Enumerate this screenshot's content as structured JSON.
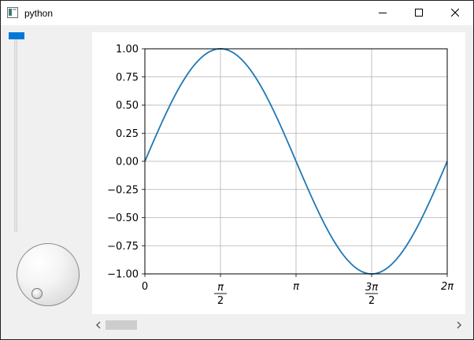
{
  "window": {
    "title": "python"
  },
  "slider": {
    "value_fraction": 1.0
  },
  "dial": {
    "value_fraction": 0.0
  },
  "chart_data": {
    "type": "line",
    "title": "",
    "xlabel": "",
    "ylabel": "",
    "xlim": [
      0,
      6.283185307179586
    ],
    "ylim": [
      -1.0,
      1.0
    ],
    "grid": true,
    "x_ticks": [
      0,
      1.5707963267948966,
      3.141592653589793,
      4.71238898038469,
      6.283185307179586
    ],
    "x_tick_labels": [
      {
        "kind": "plain",
        "text": "0"
      },
      {
        "kind": "frac",
        "num": "π",
        "den": "2"
      },
      {
        "kind": "plain",
        "text": "π"
      },
      {
        "kind": "frac",
        "num": "3π",
        "den": "2"
      },
      {
        "kind": "plain",
        "text": "2π"
      }
    ],
    "y_ticks": [
      1.0,
      0.75,
      0.5,
      0.25,
      0.0,
      -0.25,
      -0.5,
      -0.75,
      -1.0
    ],
    "y_tick_labels": [
      "1.00",
      "0.75",
      "0.50",
      "0.25",
      "0.00",
      "−0.25",
      "−0.50",
      "−0.75",
      "−1.00"
    ],
    "series": [
      {
        "color": "#1f77b4",
        "x": [
          0,
          0.3927,
          0.7854,
          1.1781,
          1.5708,
          1.9635,
          2.3562,
          2.7489,
          3.1416,
          3.5343,
          3.927,
          4.3197,
          4.7124,
          5.1051,
          5.4978,
          5.8905,
          6.2832
        ],
        "y": [
          0.0,
          0.3827,
          0.7071,
          0.9239,
          1.0,
          0.9239,
          0.7071,
          0.3827,
          0.0,
          -0.3827,
          -0.7071,
          -0.9239,
          -1.0,
          -0.9239,
          -0.7071,
          -0.3827,
          0.0
        ]
      }
    ]
  },
  "hscroll": {
    "position_fraction": 0.0
  }
}
